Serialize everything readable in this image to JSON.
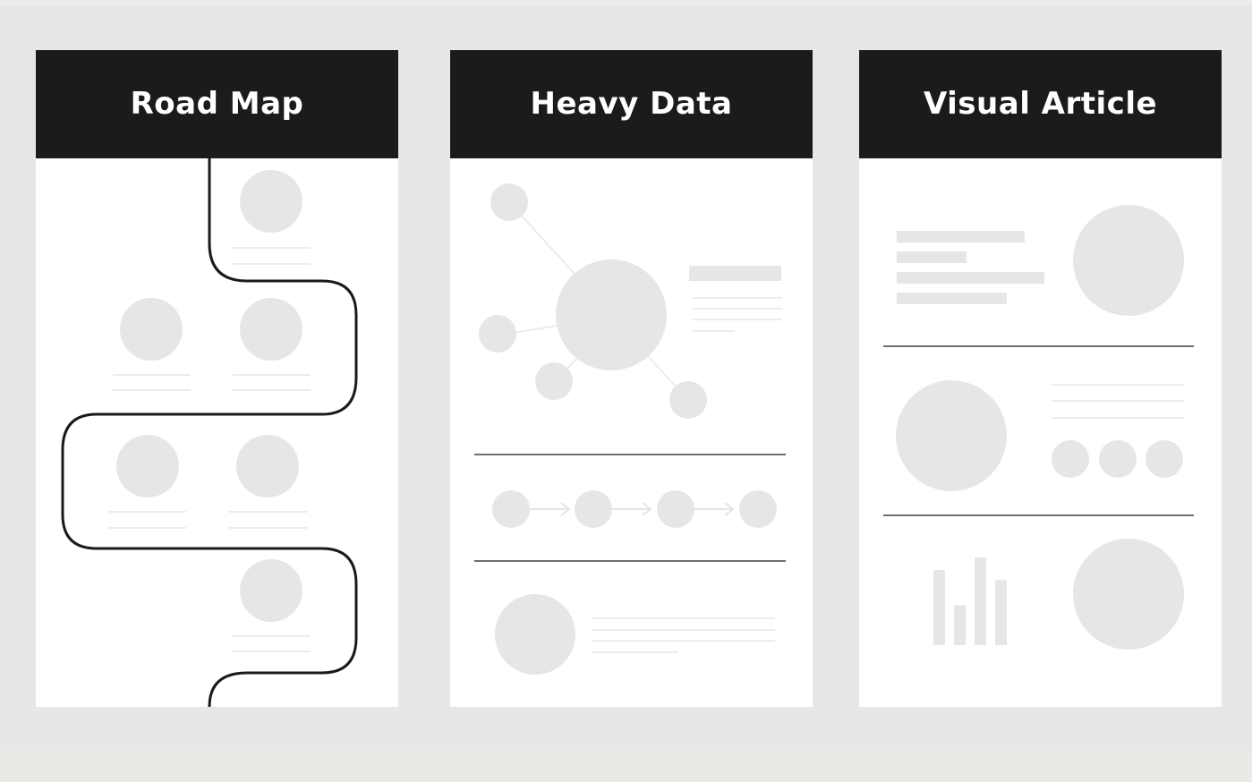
{
  "page": {
    "colors": {
      "background": "#e7e7e7",
      "card_header": "#1b1b1b",
      "card_body": "#ffffff",
      "placeholder_fill": "#e6e6e6",
      "placeholder_line": "#ececec",
      "path_stroke": "#1a1a1a",
      "divider": "#6e6e6e",
      "title_text": "#ffffff"
    }
  },
  "cards": [
    {
      "id": "road-map",
      "title": "Road Map",
      "illustration": "winding-road-with-milestone-placeholders",
      "milestones": 6
    },
    {
      "id": "heavy-data",
      "title": "Heavy Data",
      "illustration": "network-graph-process-flow-and-text-block",
      "network_nodes": 5,
      "flow_steps": 4
    },
    {
      "id": "visual-article",
      "title": "Visual Article",
      "illustration": "text-blocks-circles-and-bar-chart",
      "bar_chart_relative_values": [
        0.6,
        0.32,
        0.7,
        0.52
      ]
    }
  ]
}
